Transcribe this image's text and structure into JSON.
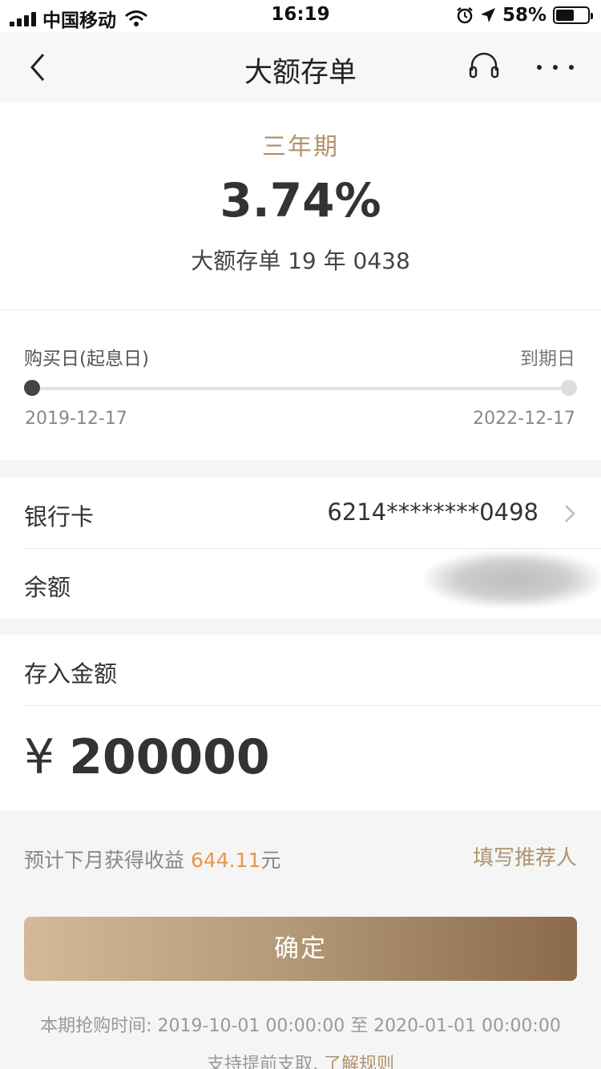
{
  "status_bar": {
    "carrier": "中国移动",
    "time": "16:19",
    "battery": "58%",
    "battery_level": 0.58,
    "icons": [
      "signal-icon",
      "wifi-icon",
      "alarm-icon",
      "location-icon",
      "battery-icon"
    ]
  },
  "nav": {
    "title": "大额存单",
    "icons": [
      "back-icon",
      "headset-icon",
      "more-icon"
    ]
  },
  "product": {
    "term": "三年期",
    "rate": "3.74%",
    "name": "大额存单 19 年 0438"
  },
  "period": {
    "start_label": "购买日(起息日)",
    "end_label": "到期日",
    "start_date": "2019-12-17",
    "end_date": "2022-12-17",
    "progress": 0
  },
  "bank": {
    "card_label": "银行卡",
    "card_number": "6214********0498",
    "balance_label": "余额"
  },
  "deposit": {
    "label": "存入金额",
    "currency": "¥",
    "amount": "200000"
  },
  "estimate": {
    "prefix": "预计下月获得收益",
    "amount": "644.11",
    "unit": "元",
    "referrer": "填写推荐人"
  },
  "confirm_label": "确定",
  "purchase_time": "本期抢购时间: 2019-10-01 00:00:00 至 2020-01-01 00:00:00",
  "early_support": {
    "text": "支持提前支取,",
    "link": "了解规则"
  },
  "colors": {
    "accent": "#b3926a",
    "income": "#e8964a",
    "button_start": "#d4b998",
    "button_end": "#8a6a4a"
  }
}
